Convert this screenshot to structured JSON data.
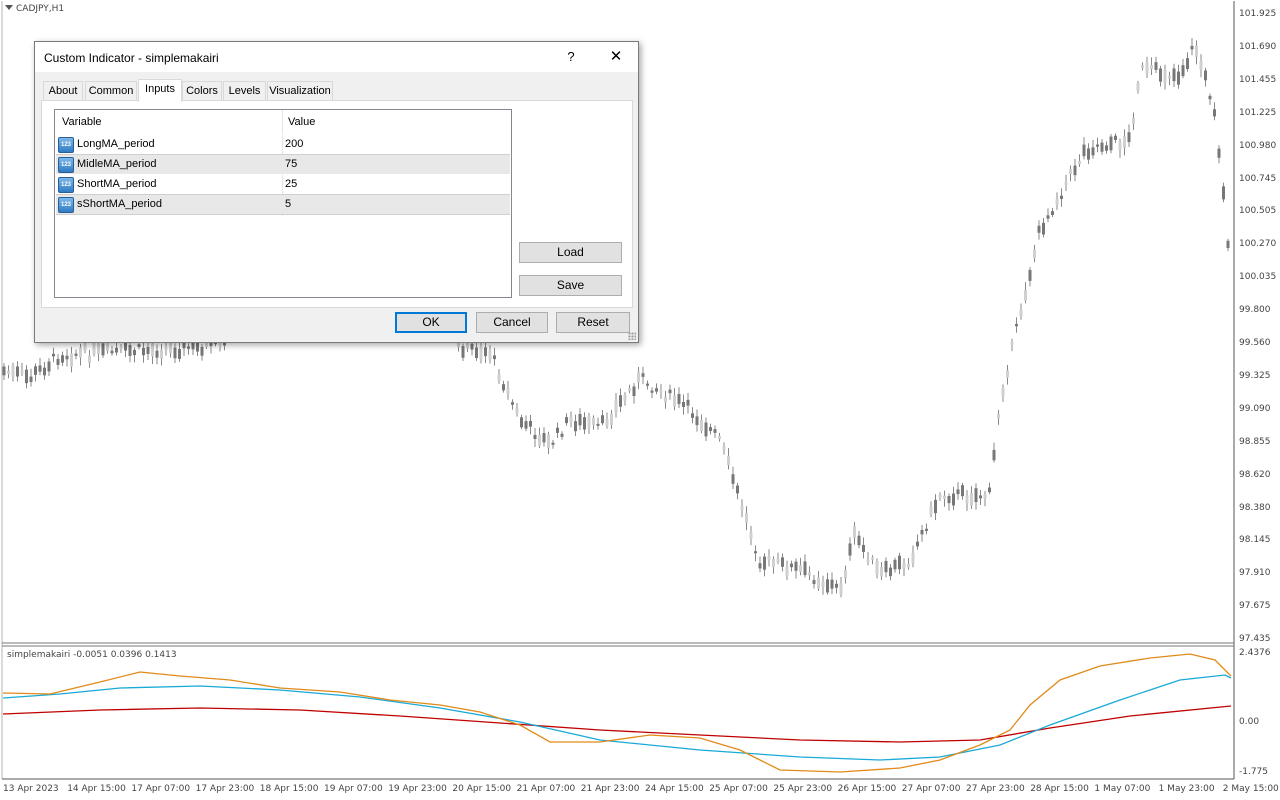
{
  "chart": {
    "symbol_title": "CADJPY,H1",
    "price_labels": [
      "101.925",
      "101.690",
      "101.455",
      "101.225",
      "100.980",
      "100.745",
      "100.505",
      "100.270",
      "100.035",
      "99.800",
      "99.560",
      "99.325",
      "99.090",
      "98.855",
      "98.620",
      "98.380",
      "98.145",
      "97.910",
      "97.675",
      "97.435"
    ],
    "indicator_title": "simplemakairi -0.0051 0.0396 0.1413",
    "indicator_labels": [
      "2.4376",
      "0.00",
      "-1.775"
    ],
    "time_labels": [
      "13 Apr 2023",
      "14 Apr 15:00",
      "17 Apr 07:00",
      "17 Apr 23:00",
      "18 Apr 15:00",
      "19 Apr 07:00",
      "19 Apr 23:00",
      "20 Apr 15:00",
      "21 Apr 07:00",
      "21 Apr 23:00",
      "24 Apr 15:00",
      "25 Apr 07:00",
      "25 Apr 23:00",
      "26 Apr 15:00",
      "27 Apr 07:00",
      "27 Apr 23:00",
      "28 Apr 15:00",
      "1 May 07:00",
      "1 May 23:00",
      "2 May 15:00"
    ],
    "colors": {
      "candle": "#777777",
      "long_ma": "#c00000",
      "midle_ma": "#19a9d6",
      "short_ma": "#e08a1a"
    }
  },
  "dialog": {
    "title": "Custom Indicator - simplemakairi",
    "help_label": "?",
    "close_label": "✕",
    "tabs": [
      "About",
      "Common",
      "Inputs",
      "Colors",
      "Levels",
      "Visualization"
    ],
    "active_tab": "Inputs",
    "table": {
      "headers": [
        "Variable",
        "Value"
      ],
      "rows": [
        {
          "icon": "123",
          "variable": "LongMA_period",
          "value": "200"
        },
        {
          "icon": "123",
          "variable": "MidleMA_period",
          "value": "75"
        },
        {
          "icon": "123",
          "variable": "ShortMA_period",
          "value": "25"
        },
        {
          "icon": "123",
          "variable": "sShortMA_period",
          "value": "5"
        }
      ]
    },
    "load_label": "Load",
    "save_label": "Save",
    "ok_label": "OK",
    "cancel_label": "Cancel",
    "reset_label": "Reset"
  }
}
